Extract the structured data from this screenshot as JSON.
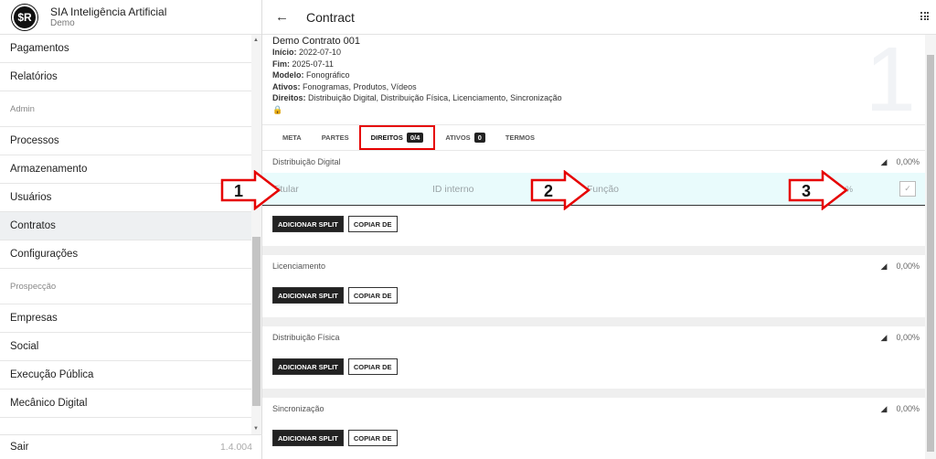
{
  "app": {
    "name": "SIA Inteligência Artificial",
    "subtitle": "Demo",
    "logo_text": "$R"
  },
  "sidebar": {
    "items": [
      {
        "type": "item",
        "label": "Pagamentos"
      },
      {
        "type": "item",
        "label": "Relatórios"
      },
      {
        "type": "section",
        "label": "Admin"
      },
      {
        "type": "item",
        "label": "Processos"
      },
      {
        "type": "item",
        "label": "Armazenamento"
      },
      {
        "type": "item",
        "label": "Usuários"
      },
      {
        "type": "item",
        "label": "Contratos",
        "active": true
      },
      {
        "type": "item",
        "label": "Configurações"
      },
      {
        "type": "section",
        "label": "Prospecção"
      },
      {
        "type": "item",
        "label": "Empresas"
      },
      {
        "type": "item",
        "label": "Social"
      },
      {
        "type": "item",
        "label": "Execução Pública"
      },
      {
        "type": "item",
        "label": "Mecânico Digital"
      }
    ],
    "footer": {
      "logout": "Sair",
      "version": "1.4.004"
    }
  },
  "header": {
    "title": "Contract",
    "back_icon": "arrow-left-icon",
    "apps_icon": "apps-grid-icon"
  },
  "contract": {
    "name": "Demo Contrato 001",
    "inicio_label": "Início:",
    "inicio": "2022-07-10",
    "fim_label": "Fim:",
    "fim": "2025-07-11",
    "modelo_label": "Modelo:",
    "modelo": "Fonográfico",
    "ativos_label": "Ativos:",
    "ativos": "Fonogramas, Produtos, Vídeos",
    "direitos_label": "Direitos:",
    "direitos": "Distribuição Digital, Distribuição Física, Licenciamento, Sincronização",
    "watermark": "1"
  },
  "tabs": [
    {
      "label": "META"
    },
    {
      "label": "PARTES"
    },
    {
      "label": "DIREITOS",
      "badge": "0/4",
      "active": true
    },
    {
      "label": "ATIVOS",
      "badge": "0"
    },
    {
      "label": "TERMOS"
    }
  ],
  "split_fields": {
    "titular": "Titular",
    "id_interno": "ID interno",
    "funcao": "Função",
    "percent": "%"
  },
  "buttons": {
    "add_split": "ADICIONAR SPLIT",
    "copy_from": "COPIAR DE"
  },
  "rights": [
    {
      "title": "Distribuição Digital",
      "percent": "0,00%",
      "editing": true
    },
    {
      "title": "Licenciamento",
      "percent": "0,00%"
    },
    {
      "title": "Distribuição Física",
      "percent": "0,00%"
    },
    {
      "title": "Sincronização",
      "percent": "0,00%"
    }
  ],
  "callouts": [
    "1",
    "2",
    "3"
  ],
  "colors": {
    "callout_red": "#e60000",
    "accent_dark": "#222222",
    "edit_row_bg": "#e9fbfc"
  }
}
